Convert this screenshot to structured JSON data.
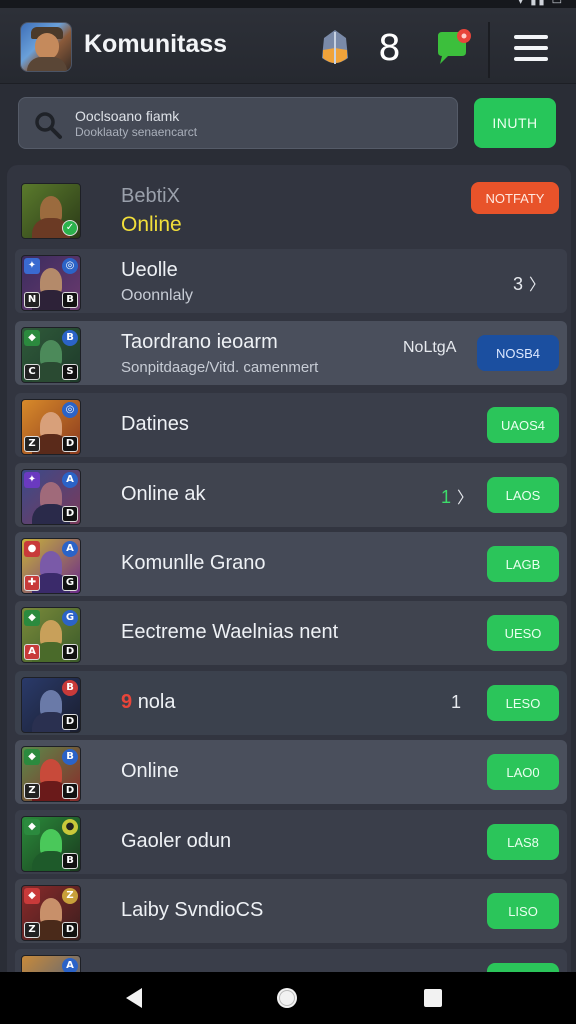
{
  "header": {
    "title": "Komunitass",
    "badge_count": "8",
    "accent": "#27c65a"
  },
  "search": {
    "line1": "Ooclsoano fiamk",
    "line2": "Dooklaaty senaencarct",
    "button_label": "INUTH"
  },
  "rows": [
    {
      "title": "BebtiX",
      "subtitle": "Online",
      "badge": "NOTFATY"
    },
    {
      "title": "Ueolle",
      "subtitle": "Ooonnlaly",
      "count": "3"
    },
    {
      "title": "Taordrano ieoarm",
      "subtitle": "Sonpitdaage/Vitd. camenmert",
      "count": "NoLtgA",
      "button": "NOSB4"
    },
    {
      "title": "Datines",
      "button": "UAOS4"
    },
    {
      "title": "Online ak",
      "count": "1",
      "button": "LAOS"
    },
    {
      "title": "Komunlle Grano",
      "button": "LAGB"
    },
    {
      "title": "Eectreme Waelnias nent",
      "button": "UESO"
    },
    {
      "title": "nola",
      "count": "1",
      "button": "LESO",
      "marker": "9"
    },
    {
      "title": "Online",
      "button": "LAO0"
    },
    {
      "title": "Gaoler odun",
      "button": "LAS8"
    },
    {
      "title": "Laiby SvndioCS",
      "button": "LISO"
    }
  ],
  "icons": {
    "status": "wifi-signal-battery",
    "shield": "shield-icon",
    "chat": "chat-bubble-icon",
    "menu": "hamburger-menu-icon",
    "search": "magnifier-icon",
    "nav_back": "back-triangle-icon",
    "nav_home": "home-circle-icon",
    "nav_recent": "recent-square-icon"
  },
  "colors": {
    "green_button": "#2bc55a",
    "orange_badge": "#e8532a",
    "blue_button": "#1b4fa0",
    "online_yellow": "#f2df3a"
  }
}
